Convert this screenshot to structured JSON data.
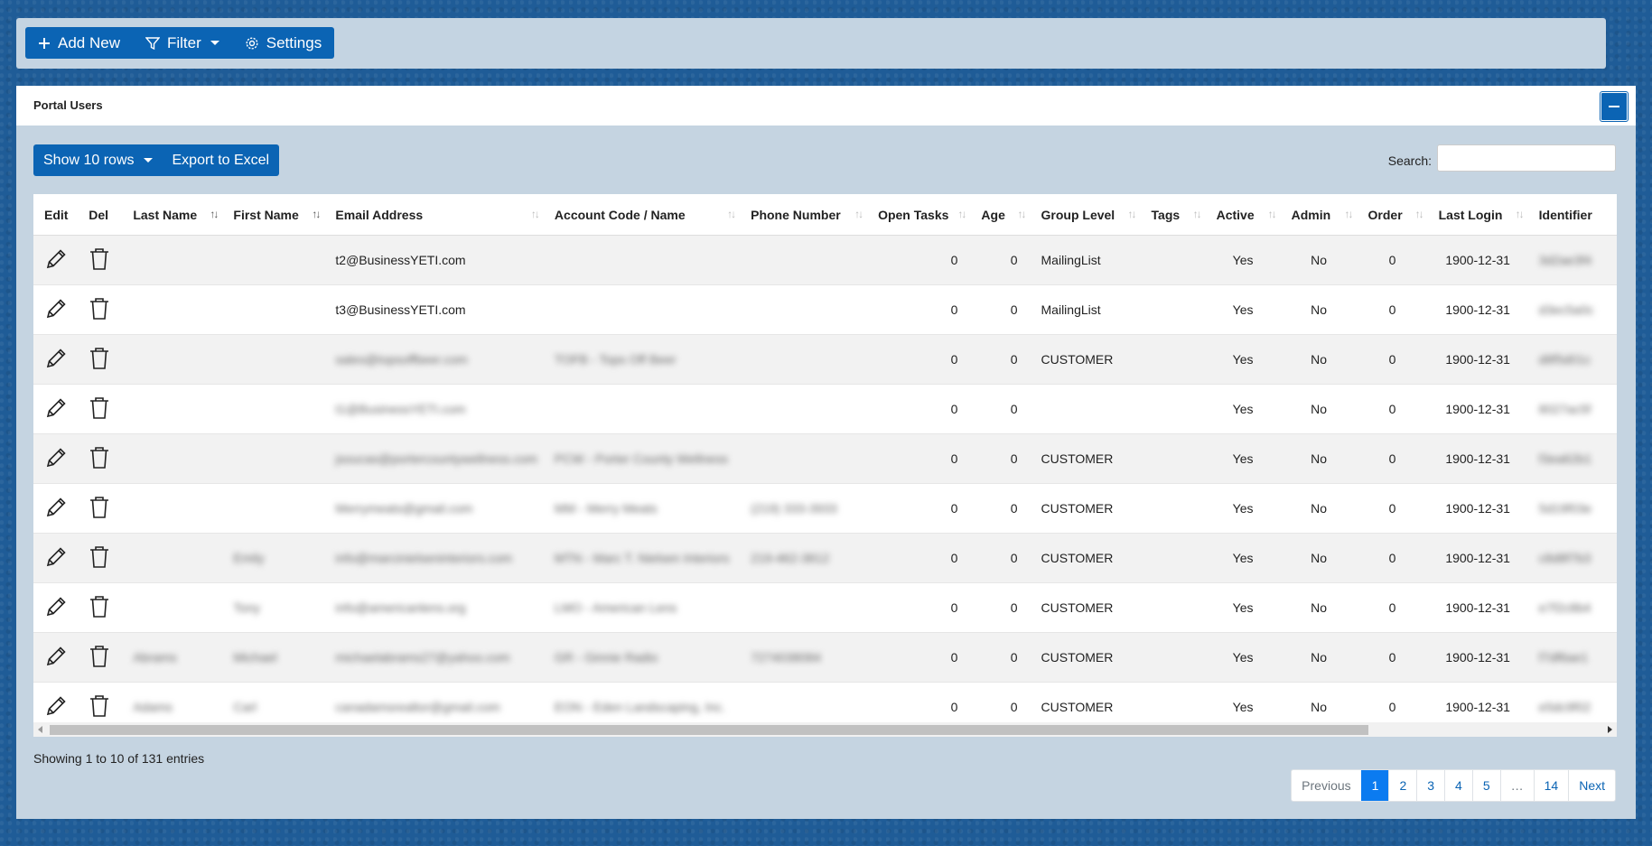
{
  "toolbar": {
    "add_label": "Add New",
    "filter_label": "Filter",
    "settings_label": "Settings"
  },
  "panel": {
    "title": "Portal Users"
  },
  "tools": {
    "rows_label": "Show 10 rows",
    "export_label": "Export to Excel",
    "search_label": "Search:",
    "search_value": ""
  },
  "columns": [
    "Edit",
    "Del",
    "Last Name",
    "First Name",
    "Email Address",
    "Account Code / Name",
    "Phone Number",
    "Open Tasks",
    "Age",
    "Group Level",
    "Tags",
    "Active",
    "Admin",
    "Order",
    "Last Login",
    "Identifier"
  ],
  "rows": [
    {
      "last": "",
      "first": "",
      "email": "t2@BusinessYETI.com",
      "account": "",
      "phone": "",
      "tasks": "0",
      "age": "0",
      "group": "MailingList",
      "tags": "",
      "active": "Yes",
      "admin": "No",
      "order": "0",
      "login": "1900-12-31",
      "id": "3d2ae3f4"
    },
    {
      "last": "",
      "first": "",
      "email": "t3@BusinessYETI.com",
      "account": "",
      "phone": "",
      "tasks": "0",
      "age": "0",
      "group": "MailingList",
      "tags": "",
      "active": "Yes",
      "admin": "No",
      "order": "0",
      "login": "1900-12-31",
      "id": "d3ec5a0c"
    },
    {
      "last": "",
      "first": "",
      "email": "sales@topsoffbeer.com",
      "account": "TOFB - Tops Off Beer",
      "phone": "",
      "tasks": "0",
      "age": "0",
      "group": "CUSTOMER",
      "tags": "",
      "active": "Yes",
      "admin": "No",
      "order": "0",
      "login": "1900-12-31",
      "id": "d8f5d01c"
    },
    {
      "last": "",
      "first": "",
      "email": "t1@BusinessYETI.com",
      "account": "",
      "phone": "",
      "tasks": "0",
      "age": "0",
      "group": "",
      "tags": "",
      "active": "Yes",
      "admin": "No",
      "order": "0",
      "login": "1900-12-31",
      "id": "8027ac5f"
    },
    {
      "last": "",
      "first": "",
      "email": "jsoucas@portercountywellness.com",
      "account": "PCW - Porter County Wellness",
      "phone": "",
      "tasks": "0",
      "age": "0",
      "group": "CUSTOMER",
      "tags": "",
      "active": "Yes",
      "admin": "No",
      "order": "0",
      "login": "1900-12-31",
      "id": "f3ea62b1"
    },
    {
      "last": "",
      "first": "",
      "email": "Merrymeats@gmail.com",
      "account": "MM - Merry Meats",
      "phone": "(219) 333-3933",
      "tasks": "0",
      "age": "0",
      "group": "CUSTOMER",
      "tags": "",
      "active": "Yes",
      "admin": "No",
      "order": "0",
      "login": "1900-12-31",
      "id": "5d19f03e"
    },
    {
      "last": "",
      "first": "Emily",
      "email": "info@marcinielseninteriors.com",
      "account": "MTN - Marc T. Nielsen Interiors",
      "phone": "219-462-3812",
      "tasks": "0",
      "age": "0",
      "group": "CUSTOMER",
      "tags": "",
      "active": "Yes",
      "admin": "No",
      "order": "0",
      "login": "1900-12-31",
      "id": "c8d8f7b3"
    },
    {
      "last": "",
      "first": "Tony",
      "email": "info@americanlens.org",
      "account": "LMO - American Lens",
      "phone": "",
      "tasks": "0",
      "age": "0",
      "group": "CUSTOMER",
      "tags": "",
      "active": "Yes",
      "admin": "No",
      "order": "0",
      "login": "1900-12-31",
      "id": "e7f2c8b4"
    },
    {
      "last": "Abrams",
      "first": "Michael",
      "email": "michaelabrams27@yahoo.com",
      "account": "GR - Ginnie Radio",
      "phone": "7274038084",
      "tasks": "0",
      "age": "0",
      "group": "CUSTOMER",
      "tags": "",
      "active": "Yes",
      "admin": "No",
      "order": "0",
      "login": "1900-12-31",
      "id": "f7df6ae1"
    },
    {
      "last": "Adams",
      "first": "Carl",
      "email": "canadamsrealtor@gmail.com",
      "account": "EON - Eden Landscaping, Inc.",
      "phone": "",
      "tasks": "0",
      "age": "0",
      "group": "CUSTOMER",
      "tags": "",
      "active": "Yes",
      "admin": "No",
      "order": "0",
      "login": "1900-12-31",
      "id": "e5dc9f02"
    }
  ],
  "info": "Showing 1 to 10 of 131 entries",
  "pagination": {
    "previous": "Previous",
    "pages": [
      "1",
      "2",
      "3",
      "4",
      "5",
      "…",
      "14"
    ],
    "next": "Next",
    "active": "1"
  },
  "colors": {
    "accent": "#0b64b4",
    "page_active": "#0b7bf0"
  }
}
